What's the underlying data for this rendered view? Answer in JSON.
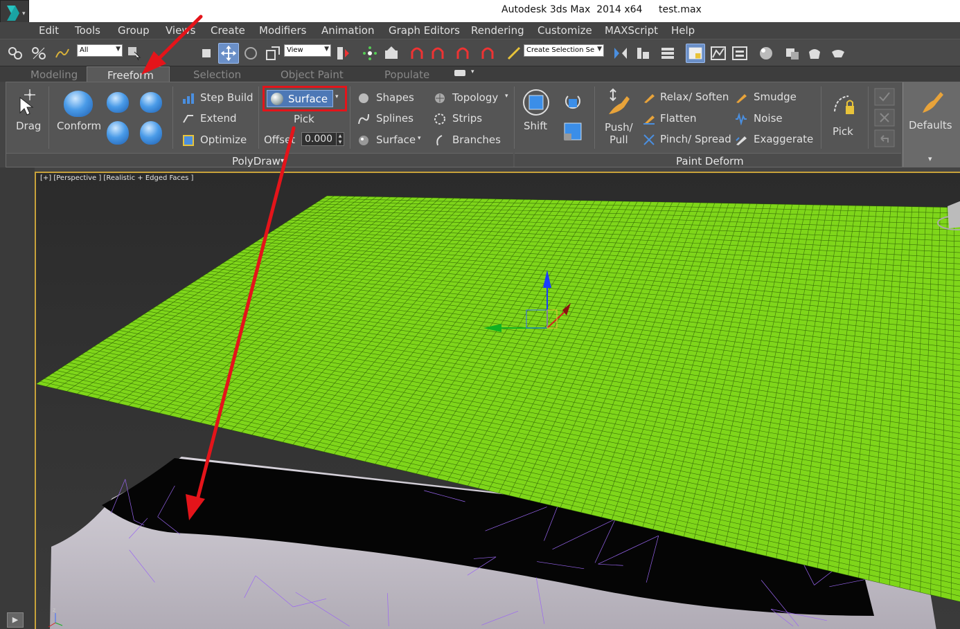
{
  "titlebar": {
    "app_title": "Autodesk 3ds Max  2014 x64",
    "file_name": "test.max"
  },
  "menu": [
    "Edit",
    "Tools",
    "Group",
    "Views",
    "Create",
    "Modifiers",
    "Animation",
    "Graph Editors",
    "Rendering",
    "Customize",
    "MAXScript",
    "Help"
  ],
  "toolbar": {
    "selection_filter": "All",
    "ref_coord": "View",
    "named_selection_placeholder": "Create Selection Se"
  },
  "ribbon_tabs": [
    "Modeling",
    "Freeform",
    "Selection",
    "Object Paint",
    "Populate"
  ],
  "active_tab": "Freeform",
  "polydraw": {
    "drag": "Drag",
    "conform": "Conform",
    "step_build": "Step Build",
    "extend": "Extend",
    "optimize": "Optimize",
    "surface_button": "Surface",
    "pick": "Pick",
    "offset_label": "Offset",
    "offset_value": "0.000",
    "shapes": "Shapes",
    "splines": "Splines",
    "surface": "Surface",
    "topology": "Topology",
    "strips": "Strips",
    "branches": "Branches",
    "footer": "PolyDraw"
  },
  "paint_deform": {
    "shift": "Shift",
    "push_pull": "Push/\nPull",
    "relax_soften": "Relax/ Soften",
    "flatten": "Flatten",
    "pinch_spread": "Pinch/ Spread",
    "smudge": "Smudge",
    "noise": "Noise",
    "exaggerate": "Exaggerate",
    "pick": "Pick",
    "footer": "Paint Deform"
  },
  "defaults": "Defaults",
  "viewport": {
    "label": "[+] [Perspective ] [Realistic + Edged Faces ]"
  },
  "colors": {
    "plane_green": "#7fd61a",
    "annotation_red": "#e4141a",
    "terrain_wire": "#9a66f2",
    "highlight_blue": "#4d78b6"
  }
}
